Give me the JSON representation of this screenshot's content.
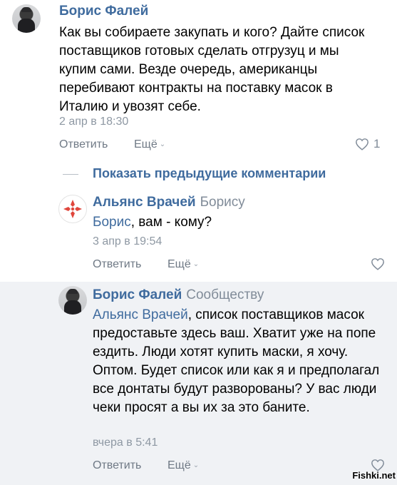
{
  "comments": [
    {
      "author": "Борис Фалей",
      "reply_to": "",
      "mention": "",
      "text": "Как вы собираете закупать и кого? Дайте список поставщиков готовых сделать отгрузуц и мы купим сами. Везде очередь, американцы перебивают контракты на поставку масок в Италию и увозят себе.",
      "date": "2 апр в 18:30",
      "reply_label": "Ответить",
      "more_label": "Ещё",
      "likes": "1"
    },
    {
      "author": "Альянс Врачей",
      "reply_to": "Борису",
      "mention": "Борис",
      "text": ", вам - кому?",
      "date": "3 апр в 19:54",
      "reply_label": "Ответить",
      "more_label": "Ещё",
      "likes": ""
    },
    {
      "author": "Борис Фалей",
      "reply_to": "Сообществу",
      "mention": "Альянс Врачей",
      "text": ", список поставщиков масок предоставьте здесь ваш. Хватит уже на попе ездить. Люди хотят купить маски, я хочу. Оптом. Будет список или как я и предполагал все донтаты будут разворованы? У вас люди чеки просят а вы их за это баните.",
      "date": "вчера в 5:41",
      "reply_label": "Ответить",
      "more_label": "Ещё",
      "likes": ""
    }
  ],
  "show_previous": "Показать предыдущие комментарии",
  "watermark": "Fishki.net",
  "icons": {
    "heart": "heart-icon",
    "chevron": "chevron-down-icon",
    "alliance_logo": "alliance-logo-icon"
  },
  "colors": {
    "link": "#3f6b9e",
    "secondary": "#818c99",
    "alliance_red": "#e0463c",
    "highlight_bg": "#f0f2f5"
  }
}
